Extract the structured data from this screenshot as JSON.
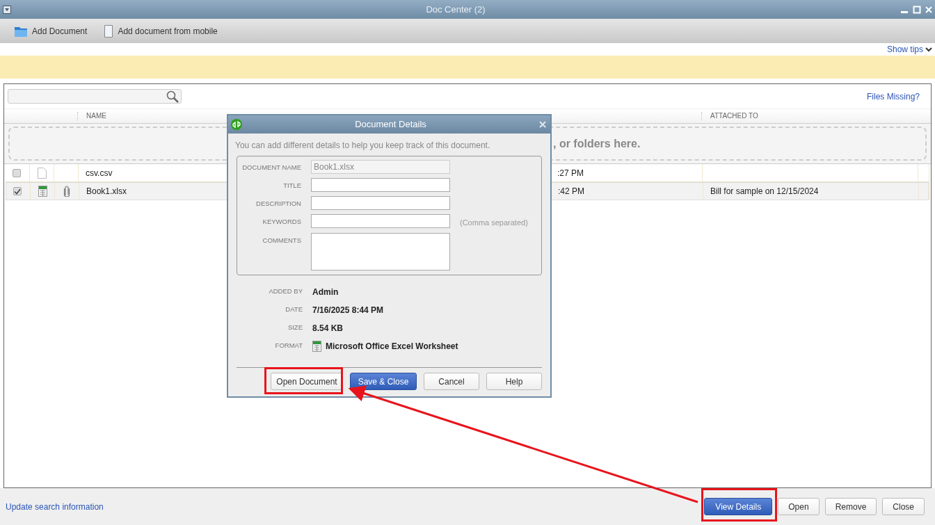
{
  "window": {
    "title": "Doc Center (2)"
  },
  "toolbar": [
    {
      "label": "Add Document",
      "kind": "folder"
    },
    {
      "label": "Add document from mobile",
      "kind": "page"
    }
  ],
  "show_tips": "Show tips",
  "files_missing": "Files Missing?",
  "table": {
    "columns": [
      "NAME",
      "ATTACHED TO"
    ],
    "drop_zone": ", or folders here.",
    "rows": [
      {
        "checked": false,
        "selected": false,
        "kind": "blank",
        "attached": false,
        "name": "csv.csv",
        "column_5": ":27 PM"
      },
      {
        "checked": true,
        "selected": true,
        "kind": "xlsx",
        "attached": true,
        "name": "Book1.xlsx",
        "column_5": ":42 PM",
        "attached_to": "Bill for sample on 12/15/2024"
      }
    ]
  },
  "dialog": {
    "title": "Document Details",
    "intro": "You can add different details to help you keep track of this document.",
    "fields": [
      {
        "label": "DOCUMENT NAME",
        "kind": "text",
        "value": "Book1.xlsx",
        "disabled": true
      },
      {
        "label": "TITLE",
        "kind": "text",
        "disabled": false
      },
      {
        "label": "DESCRIPTION",
        "kind": "text",
        "disabled": false
      },
      {
        "label": "KEYWORDS",
        "kind": "text",
        "disabled": false,
        "hint": "(Comma separated)"
      },
      {
        "label": "COMMENTS",
        "kind": "multiline",
        "disabled": false
      }
    ],
    "info": [
      {
        "label": "ADDED BY",
        "value": "Admin"
      },
      {
        "label": "DATE",
        "value": "7/16/2025 8:44 PM"
      },
      {
        "label": "SIZE",
        "value": "8.54 KB"
      },
      {
        "label": "FORMAT",
        "value": "Microsoft Office Excel Worksheet",
        "kind": "format"
      }
    ],
    "buttons": [
      {
        "label": "Open Document",
        "primary": false
      },
      {
        "label": "Save & Close",
        "primary": true
      },
      {
        "label": "Cancel",
        "primary": false
      },
      {
        "label": "Help",
        "primary": false
      }
    ]
  },
  "footer": {
    "link": "Update search information",
    "buttons": [
      {
        "label": "View Details",
        "primary": true
      },
      {
        "label": "Open",
        "primary": false
      },
      {
        "label": "Remove",
        "primary": false
      },
      {
        "label": "Close",
        "primary": false
      }
    ]
  }
}
